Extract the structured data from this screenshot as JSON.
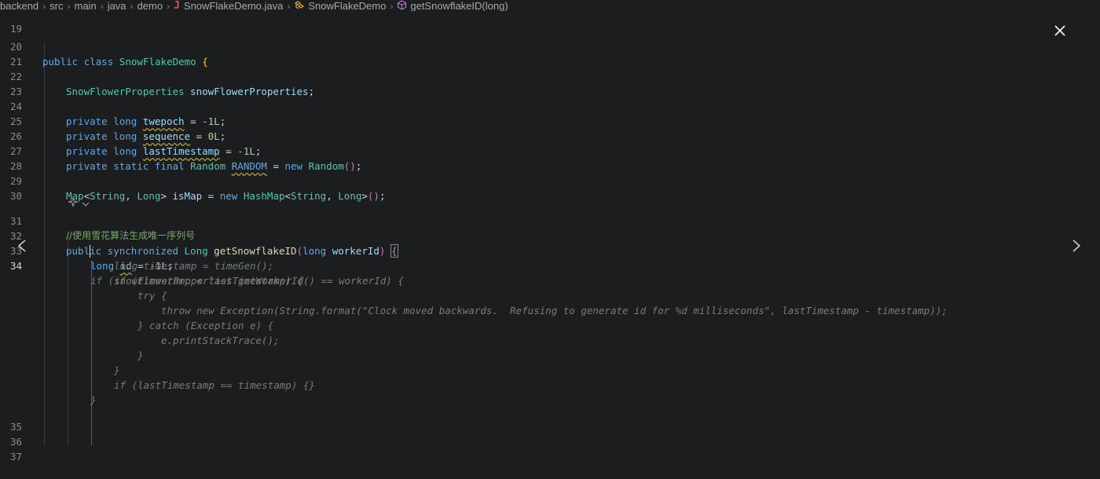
{
  "breadcrumb": {
    "items": [
      "backend",
      "src",
      "main",
      "java",
      "demo"
    ],
    "file_icon": "J",
    "file": "SnowFlakeDemo.java",
    "class": "SnowFlakeDemo",
    "method": "getSnowflakeID(long)"
  },
  "line_numbers": {
    "l19": "19",
    "l20": "20",
    "l21": "21",
    "l22": "22",
    "l23": "23",
    "l24": "24",
    "l25": "25",
    "l26": "26",
    "l27": "27",
    "l28": "28",
    "l29": "29",
    "l30": "30",
    "l31": "31",
    "l32": "32",
    "l33": "33",
    "l34": "34",
    "l35": "35",
    "l36": "36",
    "l37": "37"
  },
  "code": {
    "l20": {
      "a": "public",
      "b": "class",
      "c": "SnowFlakeDemo",
      "d": "{"
    },
    "l22": {
      "a": "SnowFlowerProperties",
      "b": "snowFlowerProperties",
      ";": ";"
    },
    "l24": {
      "a": "private",
      "b": "long",
      "c": "twepoch",
      "d": " = ",
      "e": "-1L",
      ";": ";"
    },
    "l25": {
      "a": "private",
      "b": "long",
      "c": "sequence",
      "d": " = ",
      "e": "0L",
      ";": ";"
    },
    "l26": {
      "a": "private",
      "b": "long",
      "c": "lastTimestamp",
      "d": " = ",
      "e": "-1L",
      ";": ";"
    },
    "l27": {
      "a": "private",
      "b": "static",
      "c": "final",
      "d": "Random",
      "e": "RANDOM",
      "f": " = ",
      "g": "new",
      "h": "Random",
      "i": "()",
      ";": ";"
    },
    "l29": {
      "a": "Map",
      "b": "<",
      "c": "String",
      ",": ", ",
      "d": "Long",
      "e": ">",
      "f": "isMap",
      "g": " = ",
      "h": "new",
      "i": "HashMap",
      "j": "<",
      "k": "String",
      "l": ", ",
      "m": "Long",
      "n": ">",
      "o": "()",
      ";": ";"
    },
    "l31": {
      "comment": "//使用雪花算法生成唯一序列号"
    },
    "l32": {
      "a": "public",
      "b": "synchronized",
      "c": "Long",
      "d": "getSnowflakeID",
      "e": "(",
      "f": "long",
      "g": "workerId",
      "h": ")",
      "i": "{"
    },
    "l33": {
      "a": "long",
      "b": "id",
      "c": " = ",
      "d": "-1L",
      ";": ";"
    }
  },
  "ghost": [
    "if (snowFlowerProperties.getWorkerId() == workerId) {",
    "long timestamp = timeGen();",
    "if (timestamp < lastTimestamp) {",
    "try {",
    "throw new Exception(String.format(\"Clock moved backwards.  Refusing to generate id for %d milliseconds\", lastTimestamp - timestamp));",
    "} catch (Exception e) {",
    "e.printStackTrace();",
    "}",
    "}",
    "if (lastTimestamp == timestamp) {}",
    "}"
  ],
  "colors": {
    "background": "#1b1d1f",
    "keyword": "#5ea9e9",
    "type": "#4ec9b0",
    "function": "#dcdcaa",
    "variable": "#9cdcfe",
    "number": "#b5cea8",
    "comment": "#7ca668",
    "ghost": "#7b7b7b",
    "java_icon": "#e3524f",
    "bracket": "#ffd700"
  },
  "icons": {
    "close": "close-icon",
    "prev": "chevron-left-icon",
    "next": "chevron-right-icon",
    "class": "class-icon",
    "method": "method-icon",
    "codelens": "sparkle-icon"
  }
}
